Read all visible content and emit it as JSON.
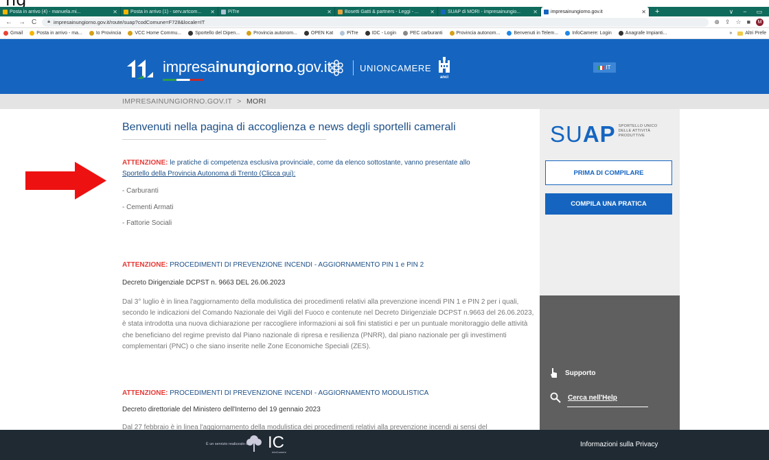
{
  "browser": {
    "tabs": [
      {
        "label": "Posta in arrivo (4) - manuela.mi...",
        "favicon_color": "#f5b400",
        "active": false
      },
      {
        "label": "Posta in arrivo (1) - serv.artcom...",
        "favicon_color": "#f5b400",
        "active": false
      },
      {
        "label": "PiTre",
        "favicon_color": "#b0c4d8",
        "active": false
      },
      {
        "label": "Bosetti Gatti & partners - Leggi - ...",
        "favicon_color": "#e8a33c",
        "active": false
      },
      {
        "label": "SUAP di MORI - impresainungio...",
        "favicon_color": "#1565c0",
        "active": false
      },
      {
        "label": "impresainungiorno.gov.it",
        "favicon_color": "#1565c0",
        "active": true
      }
    ],
    "new_tab": "+",
    "window_controls": [
      "∨",
      "−",
      "▭"
    ],
    "nav": {
      "back": "←",
      "forward": "→",
      "reload": "C"
    },
    "url": "impresainungiorno.gov.it/route/suap?codComune=F728&locale=IT",
    "avatar_letter": "M",
    "bookmarks": [
      {
        "label": "Gmail",
        "color": "#ea4335"
      },
      {
        "label": "Posta in arrivo - ma...",
        "color": "#f5b400"
      },
      {
        "label": "Io Provincia",
        "color": "#d4a017"
      },
      {
        "label": "VCC Home Commu...",
        "color": "#d4a017"
      },
      {
        "label": "Sportello del Dipen...",
        "color": "#333333"
      },
      {
        "label": "Provincia autonom...",
        "color": "#d4a017"
      },
      {
        "label": "OPEN Kat",
        "color": "#333333"
      },
      {
        "label": "PiTre",
        "color": "#b0c4d8"
      },
      {
        "label": "IDC - Login",
        "color": "#333333"
      },
      {
        "label": "PEC carburanti",
        "color": "#888888"
      },
      {
        "label": "Provincia autonom...",
        "color": "#d4a017"
      },
      {
        "label": "Benvenuti in Telem...",
        "color": "#1e88e5"
      },
      {
        "label": "InfoCamere: Login",
        "color": "#1e88e5"
      },
      {
        "label": "Anagrafe Impianti...",
        "color": "#333333"
      }
    ],
    "bookmarks_more": "»",
    "bookmarks_other": "Altri Prefe"
  },
  "header": {
    "brand_light": "impresa",
    "brand_bold_1": "inun",
    "brand_bold_2": "giorno",
    "brand_suffix": ".gov.it",
    "partner": "UNIONCAMERE",
    "anci": "anci",
    "lang": "IT"
  },
  "breadcrumb": {
    "root": "IMPRESAINUNGIORNO.GOV.IT",
    "separator": ">",
    "current": "MORI"
  },
  "main": {
    "heading": "Benvenuti nella pagina di accoglienza e news degli sportelli camerali",
    "notice1": {
      "label": "ATTENZIONE:",
      "text": " le pratiche di competenza esclusiva provinciale, come da elenco sottostante, vanno presentate allo",
      "link": "Sportello della Provincia Autonoma di Trento (Clicca qui):"
    },
    "list": [
      "- Carburanti",
      "- Cementi Armati",
      "- Fattorie Sociali"
    ],
    "notice2": {
      "label": "ATTENZIONE:",
      "title": " PROCEDIMENTI DI PREVENZIONE INCENDI - AGGIORNAMENTO PIN 1 e PIN 2",
      "decree": "Decreto Dirigenziale DCPST n. 9663 DEL 26.06.2023",
      "body": "Dal 3° luglio è in linea l'aggiornamento della modulistica dei procedimenti relativi alla prevenzione incendi PIN 1 e PIN 2 per i quali, secondo le indicazioni del Comando Nazionale dei Vigili del Fuoco e contenute nel Decreto Dirigenziale DCPST n.9663 del 26.06.2023, è stata introdotta una nuova dichiarazione per raccogliere informazioni ai soli fini statistici e per un puntuale monitoraggio delle attività che beneficiano del regime previsto dal Piano nazionale di ripresa e resilienza (PNRR), dal piano nazionale per gli investimenti complementari (PNC) o che siano inserite nelle Zone Economiche Speciali (ZES)."
    },
    "notice3": {
      "label": "ATTENZIONE:",
      "title": " PROCEDIMENTI DI PREVENZIONE INCENDI - AGGIORNAMENTO MODULISTICA",
      "decree": "Decreto direttoriale del Ministero dell'Interno del 19 gennaio 2023",
      "body": "Dal 27 febbraio è in linea l'aggiornamento della modulistica dei procedimenti relativi alla prevenzione incendi ai sensi del"
    }
  },
  "sidebar": {
    "suap_su": "SU",
    "suap_ap": "AP",
    "suap_tag": [
      "SPORTELLO UNICO",
      "DELLE ATTIVITÀ",
      "PRODUTTIVE"
    ],
    "btn_prima": "PRIMA DI COMPILARE",
    "btn_compila": "COMPILA UNA PRATICA",
    "support": "Supporto",
    "search_help": "Cerca nell'Help"
  },
  "footer": {
    "made_by": "È un servizio realizzato da",
    "ic": "IC",
    "ic_sub": "InfoCamere",
    "privacy": "Informazioni sulla Privacy"
  },
  "colors": {
    "header_blue": "#1565c0",
    "attention_red": "#e53935",
    "heading_blue": "#1c4f86",
    "footer_dark": "#1f2a33",
    "arrow_red": "#ee1111"
  }
}
